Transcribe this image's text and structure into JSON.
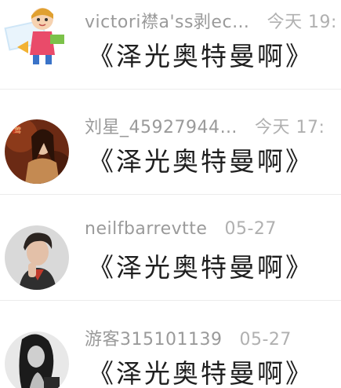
{
  "comments": [
    {
      "user": "victori襟a'ss剥ec…",
      "time": "今天 19:",
      "text": "《泽光奥特曼啊》",
      "avatar": "cartoon-child-avatar"
    },
    {
      "user": "刘星_45927944…",
      "time": "今天 17:",
      "text": "《泽光奥特曼啊》",
      "avatar": "woman-portrait-avatar"
    },
    {
      "user": "neilfbarrevtte",
      "time": "05-27",
      "text": "《泽光奥特曼啊》",
      "avatar": "young-man-photo-avatar"
    },
    {
      "user": "游客315101139",
      "time": "05-27",
      "text": "《泽光奥特曼啊》",
      "avatar": "woman-bw-photo-avatar"
    }
  ]
}
